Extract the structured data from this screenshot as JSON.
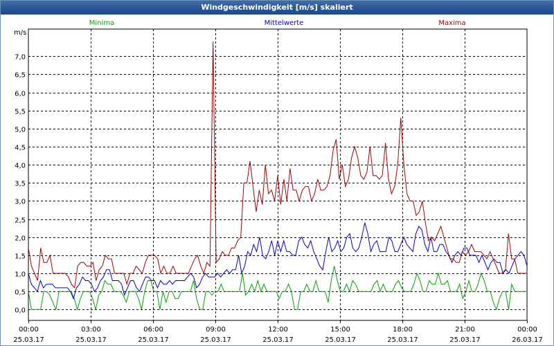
{
  "window": {
    "title": "Windgeschwindigkeit [m/s] skaliert"
  },
  "colors": {
    "minima": "#00a000",
    "mittel": "#0000c0",
    "maxima": "#a00000",
    "grid": "#000000",
    "title_bar": "#2a5590"
  },
  "chart_data": {
    "type": "line",
    "title": "Windgeschwindigkeit [m/s] skaliert",
    "ylabel": "m/s",
    "xlabel": "",
    "ylim": [
      -0.3,
      7.75
    ],
    "xlim": [
      0,
      24
    ],
    "y_ticks": [
      "0,0",
      "0,5",
      "1,0",
      "1,5",
      "2,0",
      "2,5",
      "3,0",
      "3,5",
      "4,0",
      "4,5",
      "5,0",
      "5,5",
      "6,0",
      "6,5",
      "7,0"
    ],
    "x_ticks": [
      {
        "time": "00:00",
        "date": "25.03.17"
      },
      {
        "time": "03:00",
        "date": "25.03.17"
      },
      {
        "time": "06:00",
        "date": "25.03.17"
      },
      {
        "time": "09:00",
        "date": "25.03.17"
      },
      {
        "time": "12:00",
        "date": "25.03.17"
      },
      {
        "time": "15:00",
        "date": "25.03.17"
      },
      {
        "time": "18:00",
        "date": "25.03.17"
      },
      {
        "time": "21:00",
        "date": "25.03.17"
      },
      {
        "time": "00:00",
        "date": "26.03.17"
      }
    ],
    "grid": true,
    "legend_placement": "top",
    "step_hours": 0.1667,
    "series": [
      {
        "name": "Minima",
        "color": "#00a000",
        "values": [
          0.5,
          0,
          0,
          0,
          0,
          0.5,
          0.5,
          0.4,
          0.2,
          0,
          0.5,
          0.5,
          0.5,
          0.5,
          0.5,
          0.3,
          0,
          0.3,
          0.5,
          0.5,
          0.5,
          0.3,
          0,
          0.4,
          0.5,
          0.8,
          0.7,
          0.7,
          0.5,
          0.5,
          0.5,
          0.4,
          0.2,
          0.5,
          0.5,
          0.5,
          0.3,
          0,
          0.5,
          0.8,
          0.8,
          0.5,
          0.5,
          0,
          0.5,
          0.2,
          0.5,
          0.5,
          0.3,
          0.3,
          0.5,
          0.5,
          0.5,
          0.5,
          0.8,
          0.3,
          0,
          0,
          0.5,
          0.5,
          0.4,
          0.5,
          0.5,
          0.7,
          0.5,
          0.5,
          0.5,
          0.5,
          0.5,
          0.5,
          1.0,
          0.4,
          0.5,
          0.7,
          0.5,
          0.8,
          0.5,
          0.7,
          0.5,
          0.5,
          0.5,
          0.5,
          0.3,
          0.5,
          0.5,
          0.7,
          0.5,
          0,
          0,
          0.5,
          0.5,
          0.7,
          0.5,
          0.5,
          0.8,
          0.5,
          0.5,
          0.5,
          0.2,
          0.8,
          1.2,
          0.8,
          0.5,
          0.5,
          0.7,
          0.5,
          0.8,
          0.7,
          0.5,
          0.5,
          0.5,
          0.5,
          0.5,
          0.7,
          0.8,
          0.5,
          0.7,
          0.5,
          0.5,
          0.5,
          0.7,
          0.8,
          0.6,
          0.5,
          0.5,
          0.5,
          0.7,
          1.0,
          0.8,
          0.5,
          0.5,
          0.8,
          0.7,
          0.7,
          1.0,
          0.7,
          0.7,
          0.8,
          0.5,
          0.5,
          0.5,
          0.7,
          0.3,
          0.5,
          0.8,
          0.5,
          0.5,
          0.7,
          1.0,
          0.8,
          0.5,
          0.5,
          0.2,
          0,
          0.3,
          0.5,
          0.5,
          0,
          0.7,
          0.5,
          0.5,
          0.5,
          0.5,
          0.5
        ]
      },
      {
        "name": "Mittelwerte",
        "color": "#0000c0",
        "values": [
          1.0,
          0.7,
          0.6,
          0.5,
          0.8,
          0.6,
          0.7,
          0.7,
          0.7,
          0.6,
          0.6,
          0.6,
          0.6,
          0.6,
          0.5,
          0.3,
          0.6,
          0.7,
          0.9,
          0.8,
          0.8,
          0.7,
          0.5,
          0.6,
          0.8,
          0.9,
          1.1,
          1.1,
          0.8,
          0.8,
          0.8,
          0.7,
          0.4,
          0.6,
          0.8,
          0.8,
          0.6,
          0.5,
          0.7,
          0.9,
          0.9,
          0.8,
          0.8,
          0.6,
          0.8,
          0.7,
          0.7,
          0.8,
          0.7,
          0.8,
          0.8,
          0.8,
          0.8,
          0.9,
          1.0,
          0.9,
          0.6,
          0.7,
          0.9,
          1.0,
          0.9,
          0.9,
          0.9,
          1.0,
          0.9,
          1.0,
          1.1,
          1.0,
          1.1,
          1.1,
          1.5,
          1.0,
          1.2,
          1.6,
          1.5,
          1.8,
          1.6,
          2.0,
          1.5,
          1.4,
          1.6,
          1.9,
          1.5,
          1.9,
          1.6,
          1.9,
          1.6,
          1.6,
          1.5,
          1.5,
          1.9,
          2.0,
          1.8,
          1.7,
          1.9,
          1.6,
          1.4,
          1.2,
          1.1,
          1.6,
          2.0,
          1.6,
          1.7,
          1.9,
          1.6,
          1.7,
          2.0,
          2.1,
          1.7,
          1.6,
          1.7,
          2.0,
          2.4,
          2.1,
          1.6,
          1.8,
          1.9,
          1.6,
          1.6,
          1.6,
          2.0,
          1.9,
          1.6,
          1.6,
          1.8,
          2.0,
          1.8,
          1.7,
          1.6,
          2.1,
          2.3,
          2.2,
          1.8,
          1.6,
          2.0,
          1.6,
          1.6,
          1.8,
          1.8,
          1.6,
          1.5,
          1.3,
          1.5,
          1.6,
          1.5,
          1.7,
          1.7,
          1.5,
          1.5,
          1.5,
          1.3,
          1.5,
          1.3,
          1.1,
          1.3,
          1.4,
          1.3,
          1.3,
          1.0,
          1.1,
          1.0,
          1.2,
          1.4,
          1.5,
          1.6,
          1.5,
          1.2
        ]
      },
      {
        "name": "Maxima",
        "color": "#a00000",
        "values": [
          1.7,
          1.2,
          1.0,
          0.8,
          1.7,
          1.3,
          1.3,
          1.5,
          1.0,
          1.0,
          1.0,
          1.0,
          1.0,
          0.9,
          0.7,
          0.6,
          1.2,
          1.3,
          1.3,
          1.2,
          1.2,
          1.3,
          0.8,
          1.1,
          1.2,
          1.5,
          1.4,
          1.4,
          1.0,
          1.0,
          1.0,
          1.0,
          0.7,
          1.0,
          1.0,
          1.2,
          1.1,
          1.0,
          1.3,
          1.5,
          1.5,
          1.5,
          1.4,
          1.0,
          1.2,
          1.0,
          1.0,
          1.2,
          1.0,
          1.0,
          1.0,
          1.0,
          1.0,
          1.2,
          1.4,
          1.5,
          1.2,
          1.0,
          1.3,
          1.2,
          7.4,
          1.3,
          1.4,
          1.6,
          1.5,
          1.5,
          1.7,
          1.7,
          1.9,
          2.0,
          3.5,
          3.5,
          4.1,
          3.4,
          2.7,
          3.3,
          2.9,
          4.0,
          3.2,
          3.3,
          3.0,
          3.7,
          2.9,
          3.6,
          3.0,
          3.9,
          3.3,
          3.3,
          3.0,
          3.3,
          3.4,
          3.4,
          3.0,
          3.2,
          3.6,
          3.3,
          3.3,
          3.4,
          3.7,
          4.4,
          4.7,
          3.6,
          4.0,
          3.4,
          3.6,
          4.2,
          4.5,
          4.2,
          3.7,
          3.6,
          3.8,
          4.5,
          3.7,
          3.7,
          3.6,
          3.7,
          4.6,
          3.6,
          3.2,
          3.4,
          4.0,
          5.3,
          4.0,
          3.2,
          3.0,
          3.0,
          2.6,
          2.7,
          3.0,
          2.4,
          1.9,
          2.0,
          1.9,
          2.1,
          2.3,
          2.0,
          1.7,
          1.4,
          1.4,
          1.3,
          1.3,
          1.6,
          1.5,
          1.6,
          1.8,
          1.6,
          1.6,
          1.6,
          1.5,
          1.4,
          1.6,
          1.4,
          1.2,
          1.0,
          1.0,
          1.1,
          2.1,
          1.4,
          1.4,
          1.0,
          1.0,
          1.0,
          1.0
        ]
      }
    ]
  }
}
